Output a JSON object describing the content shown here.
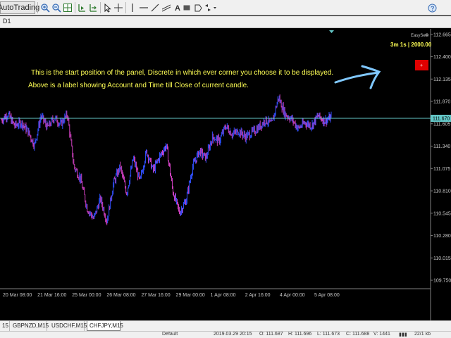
{
  "toolbar": {
    "autotrading_label": "AutoTrading",
    "icons": [
      "zoom-in-icon",
      "zoom-out-icon",
      "tile-windows-icon",
      "chart-shift-icon",
      "autoscroll-icon",
      "cursor-icon",
      "crosshair-icon",
      "vertical-line-icon",
      "horizontal-line-icon",
      "trendline-icon",
      "rectangle-icon",
      "text-label-icon",
      "arrows-icon",
      "dropdown-icon",
      "help-icon"
    ]
  },
  "chart_header": {
    "timeframe": "D1"
  },
  "panel": {
    "title": "EasySet",
    "info": "3m 1s | 2000.00",
    "close_glyph": "⊗",
    "button_glyph": "+"
  },
  "annotation": {
    "line1": "This is the start position of the panel, Discrete in which ever corner you choose it to be displayed.",
    "line2": "Above is a label showing Account and Time till Close of current candle."
  },
  "price_axis": {
    "labels": [
      "112.665",
      "112.400",
      "112.135",
      "111.870",
      "111.605",
      "111.340",
      "111.075",
      "110.810",
      "110.545",
      "110.280",
      "110.015",
      "109.750"
    ],
    "current_price": "111.670"
  },
  "time_axis": {
    "labels": [
      "20 Mar 08:00",
      "21 Mar 16:00",
      "25 Mar 00:00",
      "26 Mar 08:00",
      "27 Mar 16:00",
      "29 Mar 00:00",
      "1 Apr 08:00",
      "2 Apr 16:00",
      "4 Apr 00:00",
      "5 Apr 08:00"
    ]
  },
  "chart_data": {
    "type": "line",
    "symbol": "CHFJPY",
    "timeframe": "M15",
    "ylim": [
      109.65,
      112.73
    ],
    "x": [
      "20 Mar 08:00",
      "21 Mar 16:00",
      "25 Mar 00:00",
      "26 Mar 08:00",
      "27 Mar 16:00",
      "29 Mar 00:00",
      "1 Apr 08:00",
      "2 Apr 16:00",
      "4 Apr 00:00",
      "5 Apr 08:00"
    ],
    "series": [
      {
        "values": [
          111.65,
          111.72,
          111.58,
          111.62,
          111.52,
          111.35,
          111.7,
          111.56,
          111.68,
          111.6,
          111.72,
          111.1,
          110.95,
          110.6,
          110.48,
          110.72,
          110.45,
          110.9,
          111.1,
          110.78,
          111.2,
          110.92,
          111.28,
          111.05,
          111.22,
          111.35,
          110.8,
          110.55,
          110.7,
          111.1,
          111.28,
          111.2,
          111.45,
          111.4,
          111.58,
          111.48,
          111.52,
          111.45,
          111.5,
          111.56,
          111.65,
          111.6,
          111.92,
          111.72,
          111.66,
          111.55,
          111.62,
          111.58,
          111.7,
          111.64,
          111.68
        ]
      }
    ],
    "grid": false,
    "current_price": 111.67
  },
  "tabs": [
    {
      "label": "15"
    },
    {
      "label": "GBPNZD,M15"
    },
    {
      "label": "USDCHF,M15"
    },
    {
      "label": "CHFJPY,M15",
      "active": true
    }
  ],
  "status_bar": {
    "profile": "Default",
    "datetime": "2019.03.29 20:15",
    "open": "O: 111.687",
    "high": "H: 111.696",
    "low": "L: 111.673",
    "close": "C: 111.688",
    "volume": "V: 1441",
    "traffic": "22/1 kb"
  },
  "colors": {
    "background": "#000000",
    "candle_up": "#3050ff",
    "candle_down": "#d040c0",
    "annotation_text": "#ffff55",
    "axis_text": "#c8c8c8",
    "current_price_line": "#64c8c8",
    "arrow": "#80c8ff",
    "panel_button": "#e00000"
  }
}
